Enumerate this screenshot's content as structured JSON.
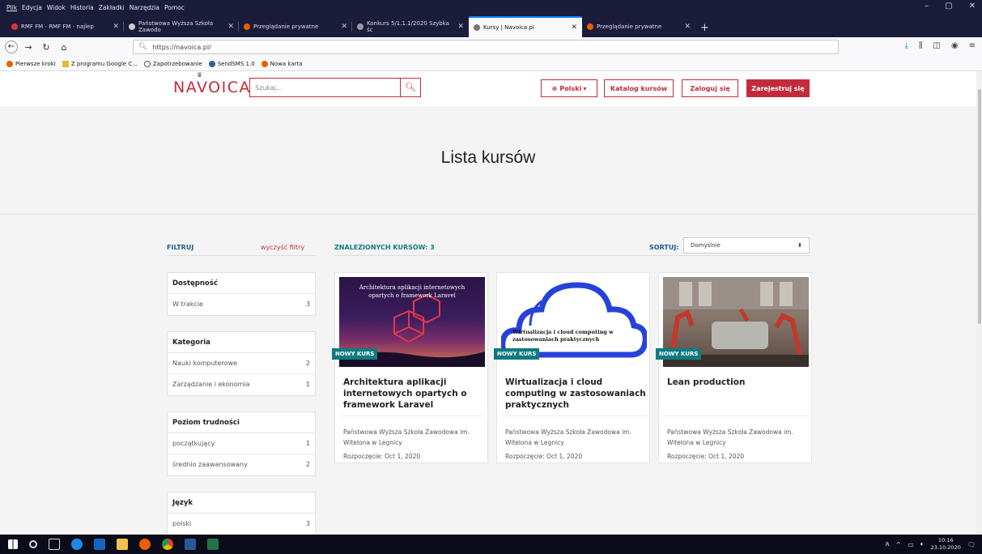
{
  "browser": {
    "menu": [
      "Plik",
      "Edycja",
      "Widok",
      "Historia",
      "Zakładki",
      "Narzędzia",
      "Pomoc"
    ],
    "tabs": [
      {
        "label": "RMF FM - RMF FM - najlep",
        "icon_color": "#d33"
      },
      {
        "label": "Państwowa Wyższa Szkoła Zawodo",
        "icon_color": "#cccccc"
      },
      {
        "label": "Przeglądanie prywatne",
        "icon_color": "#e66000"
      },
      {
        "label": "Konkurs 5/1.1.1/2020 Szybka śc",
        "icon_color": "#999999"
      },
      {
        "label": "Kursy | Navoica.pl",
        "icon_color": "#777777",
        "active": true
      },
      {
        "label": "Przeglądanie prywatne",
        "icon_color": "#e66000"
      }
    ],
    "url": "https://navoica.pl/",
    "bookmarks": [
      "Pierwsze kroki",
      "Z programu Google C...",
      "Zapotrzebowanie",
      "SendSMS 1.0",
      "Nowa karta"
    ]
  },
  "site": {
    "logo": "NAVOICA",
    "search_placeholder": "Szukaj...",
    "lang_button": "Polski",
    "catalog_button": "Katalog kursów",
    "login_button": "Zaloguj się",
    "register_button": "Zarejestruj się",
    "page_title": "Lista kursów",
    "filter_label": "FILTRUJ",
    "clear_filters": "wyczyść filtry",
    "found_label": "ZNALEZIONYCH KURSÓW: 3",
    "sort_label": "SORTUJ:",
    "sort_value": "Domyślnie"
  },
  "filters": [
    {
      "title": "Dostępność",
      "items": [
        {
          "label": "W trakcie",
          "count": "3"
        }
      ]
    },
    {
      "title": "Kategoria",
      "items": [
        {
          "label": "Nauki komputerowe",
          "count": "2"
        },
        {
          "label": "Zarządzanie i ekonomia",
          "count": "1"
        }
      ]
    },
    {
      "title": "Poziom trudności",
      "items": [
        {
          "label": "początkujący",
          "count": "1"
        },
        {
          "label": "średnio zaawansowany",
          "count": "2"
        }
      ]
    },
    {
      "title": "Język",
      "items": [
        {
          "label": "polski",
          "count": "3"
        }
      ]
    }
  ],
  "courses": [
    {
      "thumb_text": "Architektura aplikacji internetowych opartych o framework Laravel",
      "badge": "NOWY KURS",
      "title": "Architektura aplikacji internetowych opartych o framework Laravel",
      "org": "Państwowa Wyższa Szkoła Zawodowa im. Witelona w Legnicy",
      "date": "Rozpoczęcie: Oct 1, 2020"
    },
    {
      "thumb_text": "Wirtualizacja i cloud computing w zastosowaniach praktycznych",
      "badge": "NOWY KURS",
      "title": "Wirtualizacja i cloud computing w zastosowaniach praktycznych",
      "org": "Państwowa Wyższa Szkoła Zawodowa im. Witelona w Legnicy",
      "date": "Rozpoczęcie: Oct 1, 2020"
    },
    {
      "thumb_text": "",
      "badge": "NOWY KURS",
      "title": "Lean production",
      "org": "Państwowa Wyższa Szkoła Zawodowa im. Witelona w Legnicy",
      "date": "Rozpoczęcie: Oct 1, 2020"
    }
  ],
  "taskbar": {
    "time": "10:16",
    "date": "23.10.2020"
  },
  "colors": {
    "brand": "#c42b3a",
    "badge": "#0f7b80",
    "chrome": "#1b1b3a"
  }
}
